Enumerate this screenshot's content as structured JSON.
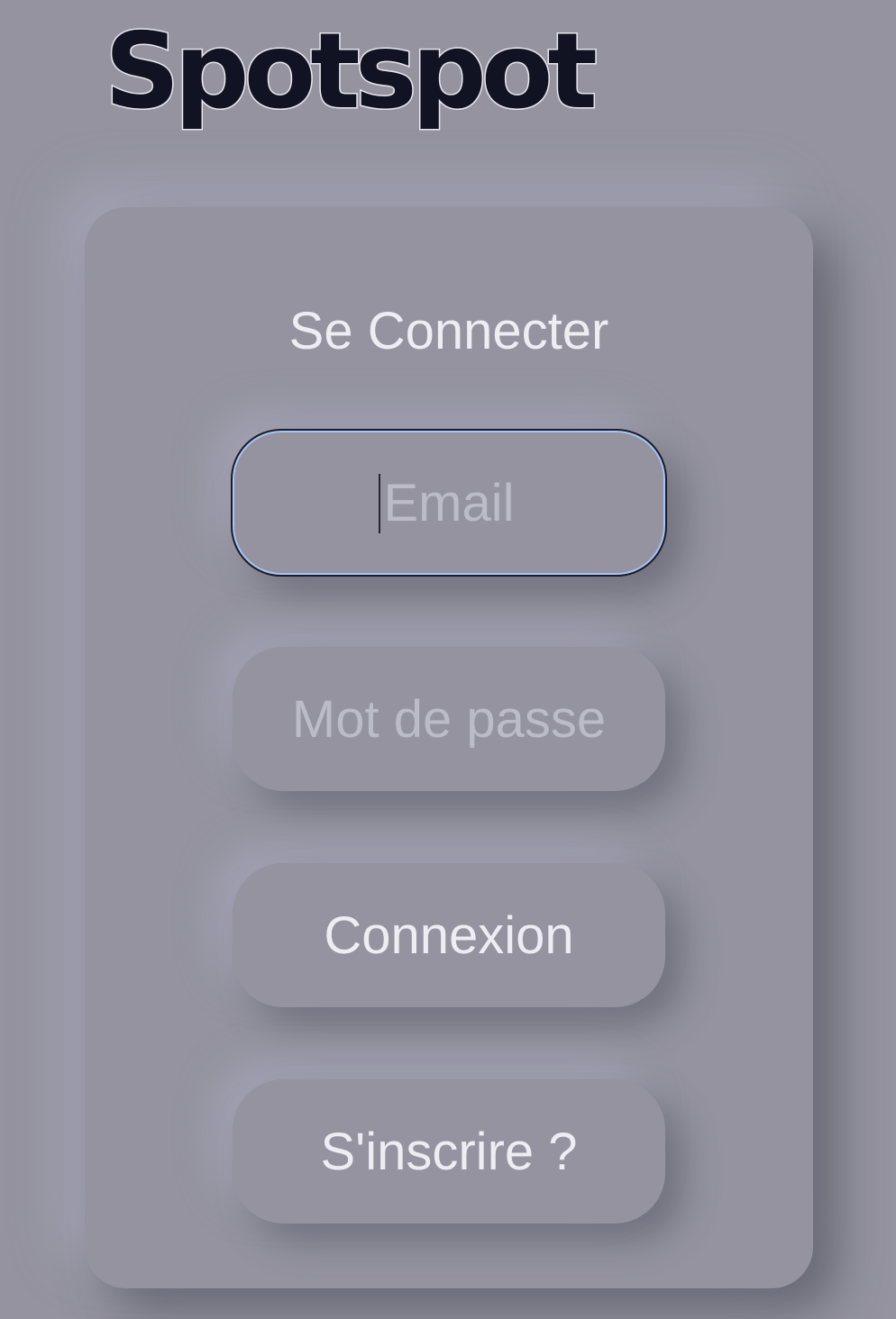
{
  "brand": {
    "name": "Spotspot"
  },
  "login": {
    "title": "Se Connecter",
    "email_placeholder": "Email",
    "email_value": "",
    "password_placeholder": "Mot de passe",
    "password_value": "",
    "submit_label": "Connexion",
    "register_label": "S'inscrire ?"
  },
  "colors": {
    "background": "#94939f",
    "text": "#eeedf3",
    "placeholder": "#bcbcc9",
    "brand_text": "#111322",
    "focus_ring": "#a7c5f7"
  }
}
